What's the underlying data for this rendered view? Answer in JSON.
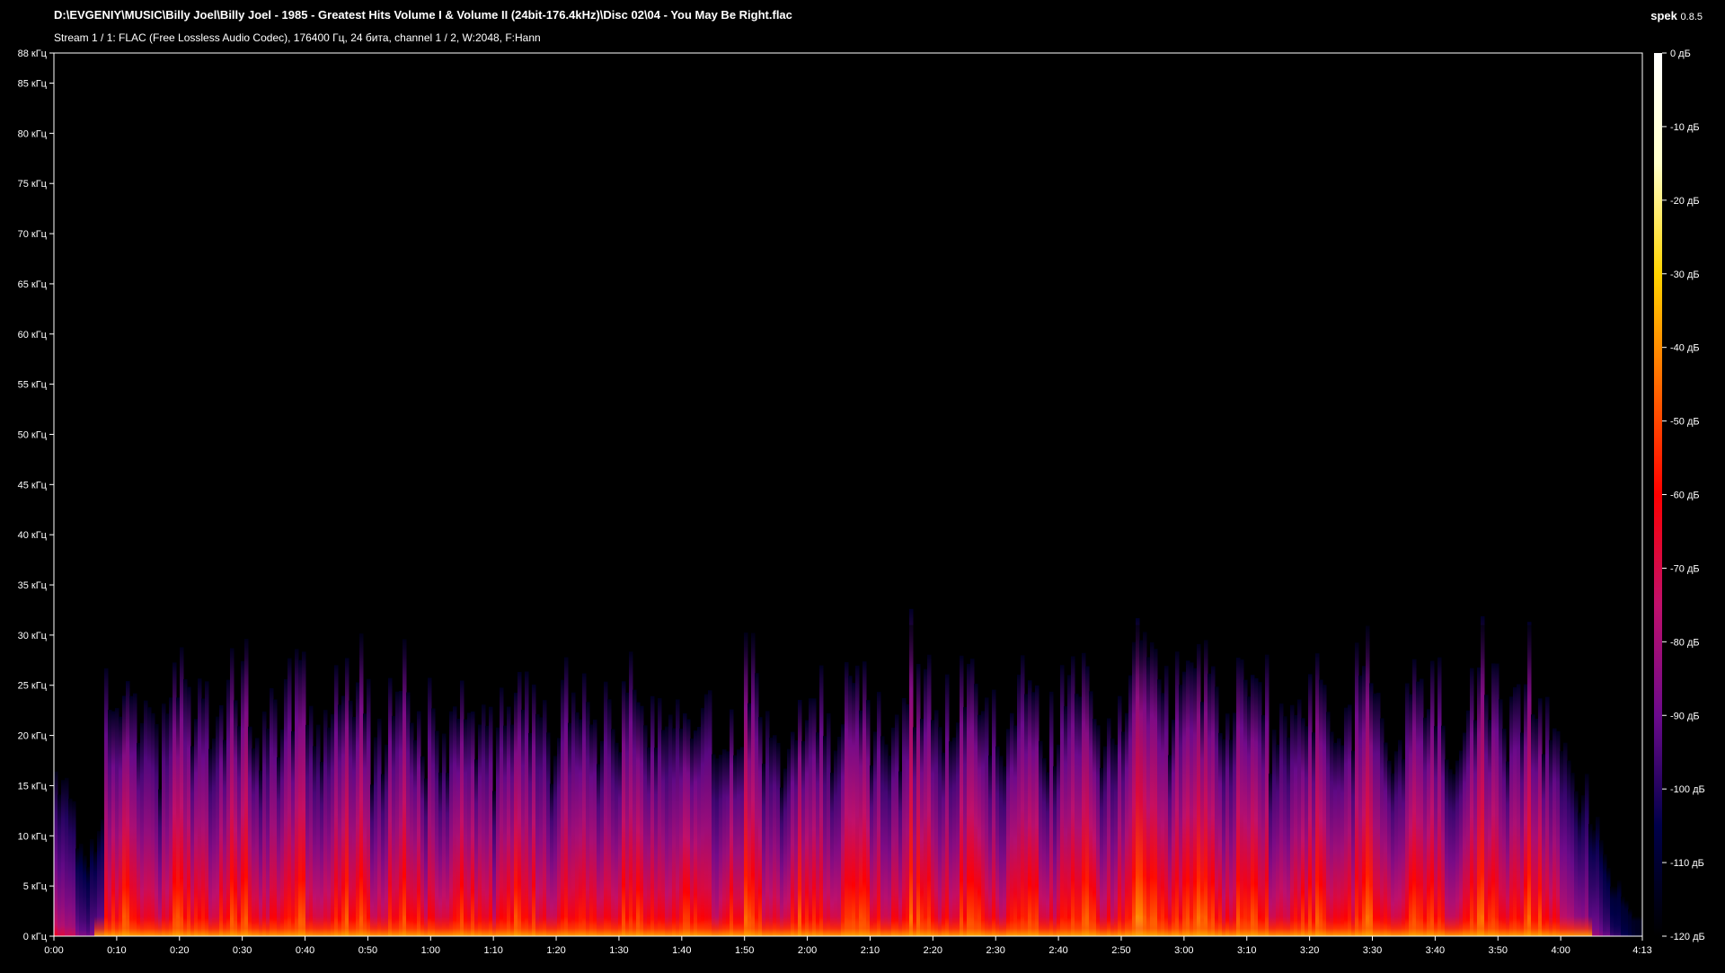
{
  "header": {
    "file_path": "D:\\EVGENIY\\MUSIC\\Billy Joel\\Billy Joel - 1985 - Greatest Hits Volume I & Volume II (24bit-176.4kHz)\\Disc 02\\04 - You May Be Right.flac",
    "stream_info": "Stream 1 / 1: FLAC (Free Lossless Audio Codec), 176400 Гц, 24 бита, channel 1 / 2, W:2048, F:Hann",
    "app_name": "spek",
    "app_version": "0.8.5"
  },
  "spectrogram": {
    "frequency_max_khz": 88,
    "duration_seconds": 253,
    "content_upper_limit_khz": 30,
    "frequency_ticks": [
      {
        "value": 0,
        "label": "0 кГц"
      },
      {
        "value": 5,
        "label": "5 кГц"
      },
      {
        "value": 10,
        "label": "10 кГц"
      },
      {
        "value": 15,
        "label": "15 кГц"
      },
      {
        "value": 20,
        "label": "20 кГц"
      },
      {
        "value": 25,
        "label": "25 кГц"
      },
      {
        "value": 30,
        "label": "30 кГц"
      },
      {
        "value": 35,
        "label": "35 кГц"
      },
      {
        "value": 40,
        "label": "40 кГц"
      },
      {
        "value": 45,
        "label": "45 кГц"
      },
      {
        "value": 50,
        "label": "50 кГц"
      },
      {
        "value": 55,
        "label": "55 кГц"
      },
      {
        "value": 60,
        "label": "60 кГц"
      },
      {
        "value": 65,
        "label": "65 кГц"
      },
      {
        "value": 70,
        "label": "70 кГц"
      },
      {
        "value": 75,
        "label": "75 кГц"
      },
      {
        "value": 80,
        "label": "80 кГц"
      },
      {
        "value": 85,
        "label": "85 кГц"
      },
      {
        "value": 88,
        "label": "88 кГц"
      }
    ],
    "time_ticks": [
      {
        "value": 0,
        "label": "0:00"
      },
      {
        "value": 10,
        "label": "0:10"
      },
      {
        "value": 20,
        "label": "0:20"
      },
      {
        "value": 30,
        "label": "0:30"
      },
      {
        "value": 40,
        "label": "0:40"
      },
      {
        "value": 50,
        "label": "0:50"
      },
      {
        "value": 60,
        "label": "1:00"
      },
      {
        "value": 70,
        "label": "1:10"
      },
      {
        "value": 80,
        "label": "1:20"
      },
      {
        "value": 90,
        "label": "1:30"
      },
      {
        "value": 100,
        "label": "1:40"
      },
      {
        "value": 110,
        "label": "1:50"
      },
      {
        "value": 120,
        "label": "2:00"
      },
      {
        "value": 130,
        "label": "2:10"
      },
      {
        "value": 140,
        "label": "2:20"
      },
      {
        "value": 150,
        "label": "2:30"
      },
      {
        "value": 160,
        "label": "2:40"
      },
      {
        "value": 170,
        "label": "2:50"
      },
      {
        "value": 180,
        "label": "3:00"
      },
      {
        "value": 190,
        "label": "3:10"
      },
      {
        "value": 200,
        "label": "3:20"
      },
      {
        "value": 210,
        "label": "3:30"
      },
      {
        "value": 220,
        "label": "3:40"
      },
      {
        "value": 230,
        "label": "3:50"
      },
      {
        "value": 240,
        "label": "4:00"
      },
      {
        "value": 253,
        "label": "4:13"
      }
    ]
  },
  "color_scale": {
    "db_min": -120,
    "db_max": 0,
    "ticks": [
      {
        "value": 0,
        "label": "0 дБ"
      },
      {
        "value": -10,
        "label": "-10 дБ"
      },
      {
        "value": -20,
        "label": "-20 дБ"
      },
      {
        "value": -30,
        "label": "-30 дБ"
      },
      {
        "value": -40,
        "label": "-40 дБ"
      },
      {
        "value": -50,
        "label": "-50 дБ"
      },
      {
        "value": -60,
        "label": "-60 дБ"
      },
      {
        "value": -70,
        "label": "-70 дБ"
      },
      {
        "value": -80,
        "label": "-80 дБ"
      },
      {
        "value": -90,
        "label": "-90 дБ"
      },
      {
        "value": -100,
        "label": "-100 дБ"
      },
      {
        "value": -110,
        "label": "-110 дБ"
      },
      {
        "value": -120,
        "label": "-120 дБ"
      }
    ],
    "colors": [
      "#000000",
      "#00004a",
      "#6c0a8c",
      "#c0106c",
      "#ff0000",
      "#ff6a00",
      "#ffd400",
      "#ffffc8",
      "#ffffff"
    ]
  }
}
